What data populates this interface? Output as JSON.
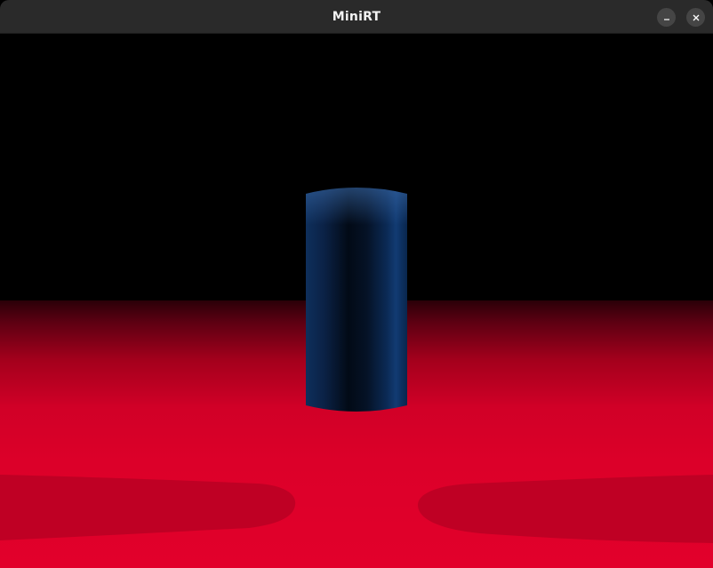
{
  "window": {
    "title": "MiniRT",
    "buttons": [
      {
        "name": "minimize",
        "icon": "minimize-icon"
      },
      {
        "name": "close",
        "icon": "close-icon"
      }
    ]
  },
  "scene": {
    "background_color": "#000000",
    "floor_color": "#e0002a",
    "floor_shadow_color": "#bf0024",
    "object_color": "#0d2c57",
    "objects": [
      "cylinder",
      "plane"
    ]
  }
}
